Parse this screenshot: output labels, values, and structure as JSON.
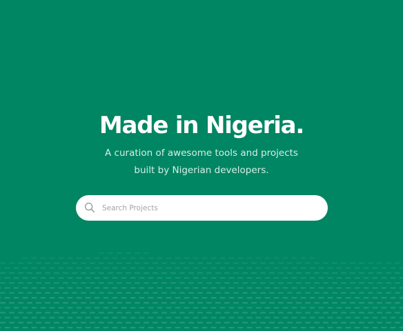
{
  "hero": {
    "title": "Made in Nigeria.",
    "subtitle_line1": "A curation of awesome tools and projects",
    "subtitle_line2": "built by Nigerian developers."
  },
  "search": {
    "placeholder": "Search Projects",
    "value": "",
    "icon": "search-icon"
  },
  "colors": {
    "background": "#008663",
    "pattern_dash": "#2a9a7b",
    "search_bg": "#ffffff"
  }
}
